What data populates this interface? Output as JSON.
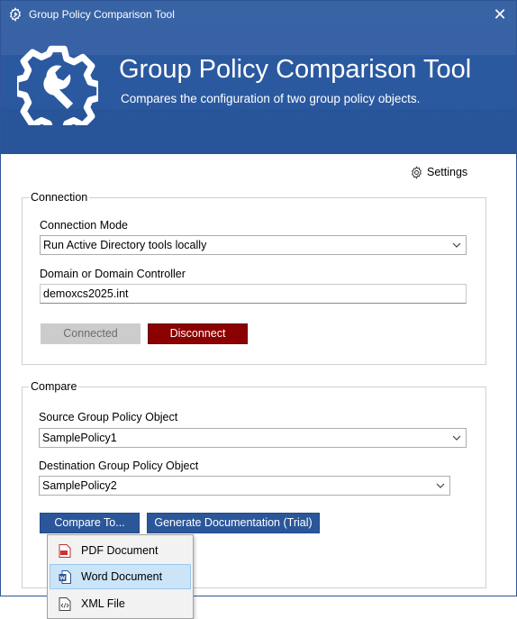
{
  "window": {
    "title": "Group Policy Comparison Tool",
    "close_glyph": "✕"
  },
  "header": {
    "title": "Group Policy Comparison Tool",
    "subtitle": "Compares the configuration of two group policy objects.",
    "icon": "gear-wrench-icon"
  },
  "settings": {
    "label": "Settings",
    "icon": "gear-icon"
  },
  "connection": {
    "group_label": "Connection",
    "mode_label": "Connection Mode",
    "mode_value": "Run Active Directory tools locally",
    "domain_label": "Domain or Domain Controller",
    "domain_value": "demoxcs2025.int",
    "connected_label": "Connected",
    "disconnect_label": "Disconnect"
  },
  "compare": {
    "group_label": "Compare",
    "source_label": "Source Group Policy Object",
    "source_value": "SamplePolicy1",
    "destination_label": "Destination Group Policy Object",
    "destination_value": "SamplePolicy2",
    "compare_to_label": "Compare To...",
    "generate_label": "Generate Documentation (Trial)"
  },
  "menu": {
    "items": [
      {
        "label": "PDF Document",
        "icon": "pdf-icon"
      },
      {
        "label": "Word Document",
        "icon": "word-icon",
        "highlighted": true
      },
      {
        "label": "XML File",
        "icon": "xml-file-icon"
      }
    ]
  },
  "colors": {
    "banner": "#2c5aa0",
    "primary_button": "#2b579a",
    "danger_button": "#8b0000",
    "disabled_button": "#cccccc",
    "menu_highlight": "#cce4f7"
  }
}
